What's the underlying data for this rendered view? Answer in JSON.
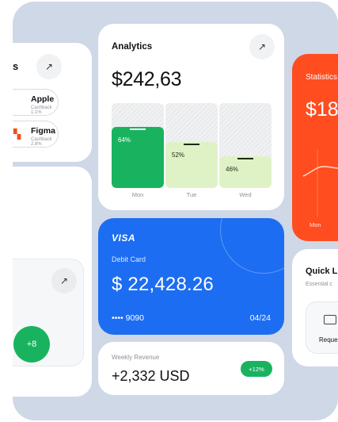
{
  "cashback_card": {
    "title": "s",
    "arrow_icon": "arrow-up-right-icon",
    "items": [
      {
        "name": "Apple",
        "sub": "Cashback 1.1%",
        "logo": ""
      },
      {
        "name": "Figma",
        "sub": "Cashback 2.8%",
        "logo": "▚"
      }
    ]
  },
  "left_mid_card": {
    "arrow_icon": "arrow-up-right-icon",
    "badge": "+8"
  },
  "analytics": {
    "title": "Analytics",
    "amount": "$242,63",
    "arrow_icon": "arrow-up-right-icon",
    "bars": [
      {
        "day": "Mon",
        "pct_label": "64%",
        "value": 0.72,
        "color": "#19b35f",
        "text_color": "#ffffff",
        "tick_color": "#ffffff"
      },
      {
        "day": "Tue",
        "pct_label": "52%",
        "value": 0.54,
        "color": "#dff2c6",
        "text_color": "#1c2b12",
        "tick_color": "#1c2b12"
      },
      {
        "day": "Wed",
        "pct_label": "46%",
        "value": 0.37,
        "color": "#dff2c6",
        "text_color": "#1c2b12",
        "tick_color": "#1c2b12"
      }
    ]
  },
  "debit_card": {
    "brand": "VISA",
    "type": "Debit Card",
    "amount": "$ 22,428.26",
    "number": "•••• 9090",
    "expiry": "04/24",
    "color": "#1c6df2"
  },
  "weekly_revenue": {
    "label": "Weekly Revenue",
    "amount": "+2,332 USD",
    "badge": "+12%",
    "badge_color": "#19b35f"
  },
  "statistics": {
    "title": "Statistics",
    "amount": "$18",
    "day": "Mon",
    "color": "#ff4d1f"
  },
  "quick_links": {
    "title": "Quick Links",
    "subtitle": "Essential c",
    "item_label": "Request",
    "item_icon": "card-icon"
  }
}
